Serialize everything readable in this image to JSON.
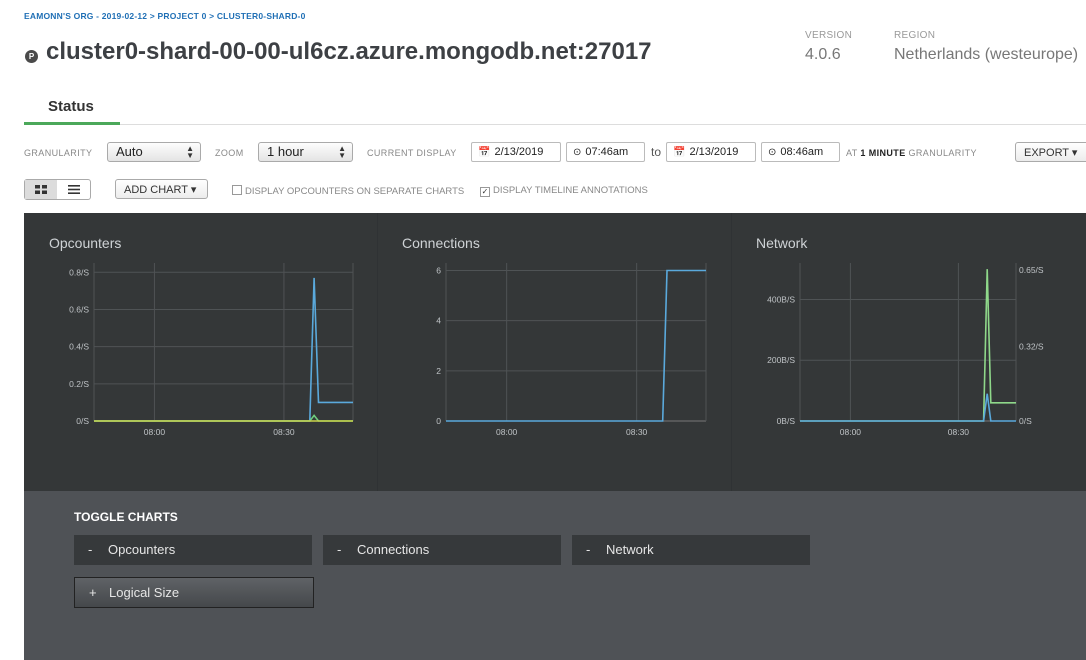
{
  "breadcrumb": "EAMONN'S ORG - 2019-02-12 > PROJECT 0 > CLUSTER0-SHARD-0",
  "header": {
    "badge": "P",
    "title": "cluster0-shard-00-00-ul6cz.azure.mongodb.net:27017",
    "version_label": "VERSION",
    "version": "4.0.6",
    "region_label": "REGION",
    "region": "Netherlands (westeurope)"
  },
  "tabs": [
    {
      "label": "Status",
      "active": true
    }
  ],
  "controls": {
    "granularity_label": "GRANULARITY",
    "granularity": "Auto",
    "zoom_label": "ZOOM",
    "zoom": "1 hour",
    "current_display_label": "CURRENT DISPLAY",
    "from_date": "2/13/2019",
    "from_time": "07:46am",
    "to_word": "to",
    "to_date": "2/13/2019",
    "to_time": "08:46am",
    "at_text": "AT",
    "granularity_value": "1 MINUTE",
    "granularity_suffix": "GRANULARITY",
    "export": "EXPORT"
  },
  "toolbar": {
    "add_chart": "ADD CHART",
    "separate_label": "DISPLAY OPCOUNTERS ON SEPARATE CHARTS",
    "separate_checked": false,
    "timeline_label": "DISPLAY TIMELINE ANNOTATIONS",
    "timeline_checked": true
  },
  "charts": [
    {
      "title": "Opcounters",
      "y_ticks": [
        "0.8/S",
        "0.6/S",
        "0.4/S",
        "0.2/S",
        "0/S"
      ],
      "x_ticks": [
        "08:00",
        "08:30"
      ]
    },
    {
      "title": "Connections",
      "y_ticks": [
        "6",
        "4",
        "2",
        "0"
      ],
      "x_ticks": [
        "08:00",
        "08:30"
      ]
    },
    {
      "title": "Network",
      "y_ticks": [
        "400B/S",
        "200B/S",
        "0B/S"
      ],
      "y2_ticks": [
        "0.65/S",
        "0.32/S",
        "0/S"
      ],
      "x_ticks": [
        "08:00",
        "08:30"
      ]
    }
  ],
  "chart_data": [
    {
      "type": "line",
      "title": "Opcounters",
      "x": [
        "07:46",
        "08:36",
        "08:37",
        "08:38",
        "08:39",
        "08:40",
        "08:46"
      ],
      "ylim": [
        0,
        0.85
      ],
      "yticks": [
        "0/S",
        "0.2/S",
        "0.4/S",
        "0.6/S",
        "0.8/S"
      ],
      "xticks": [
        "08:00",
        "08:30"
      ],
      "series": [
        {
          "color": "#5aa9dc",
          "values": [
            0,
            0,
            0.77,
            0.1,
            0.1,
            0.1,
            0.1
          ]
        },
        {
          "color": "#6fcf7f",
          "values": [
            0,
            0,
            0.03,
            0,
            0,
            0,
            0
          ]
        },
        {
          "color": "#c9d34b",
          "values": [
            0,
            0,
            0,
            0,
            0,
            0,
            0
          ]
        }
      ]
    },
    {
      "type": "line",
      "title": "Connections",
      "x": [
        "07:46",
        "08:36",
        "08:37",
        "08:46"
      ],
      "ylim": [
        0,
        6.3
      ],
      "yticks": [
        "0",
        "2",
        "4",
        "6"
      ],
      "xticks": [
        "08:00",
        "08:30"
      ],
      "series": [
        {
          "color": "#5aa9dc",
          "values": [
            0,
            0,
            6,
            6
          ]
        }
      ]
    },
    {
      "type": "line",
      "title": "Network",
      "x": [
        "07:46",
        "08:37",
        "08:38",
        "08:39",
        "08:40",
        "08:46"
      ],
      "ylim": [
        0,
        520
      ],
      "yticks": [
        "0B/S",
        "200B/S",
        "400B/S"
      ],
      "y2ticks": [
        "0/S",
        "0.32/S",
        "0.65/S"
      ],
      "xticks": [
        "08:00",
        "08:30"
      ],
      "series": [
        {
          "color": "#8fd88a",
          "values": [
            0,
            0,
            500,
            60,
            60,
            60
          ]
        },
        {
          "color": "#5aa9dc",
          "values": [
            0,
            0,
            90,
            0,
            0,
            0
          ]
        }
      ]
    }
  ],
  "toggle": {
    "title": "TOGGLE CHARTS",
    "items": [
      {
        "sign": "-",
        "label": "Opcounters"
      },
      {
        "sign": "-",
        "label": "Connections"
      },
      {
        "sign": "-",
        "label": "Network"
      },
      {
        "sign": "+",
        "label": "Logical Size"
      }
    ]
  },
  "colors": {
    "accent": "#4ba85a",
    "link": "#1f6fb5",
    "chart_bg": "#343738"
  }
}
